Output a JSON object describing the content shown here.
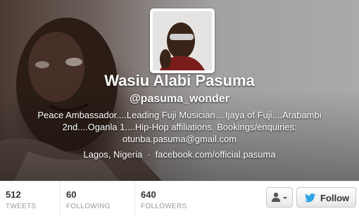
{
  "profile": {
    "name": "Wasiu Alabi Pasuma",
    "handle": "@pasuma_wonder",
    "bio": "Peace Ambassador....Leading Fuji Musician....Ijaya of Fuji....Arabambi 2nd....Oganla 1....Hip-Hop affiliations. Bookings/enquiries: otunba.pasuma@gmail.com",
    "location": "Lagos, Nigeria",
    "separator": "·",
    "website": "facebook.com/official.pasuma"
  },
  "stats": [
    {
      "value": "512",
      "label": "TWEETS"
    },
    {
      "value": "60",
      "label": "FOLLOWING"
    },
    {
      "value": "640",
      "label": "FOLLOWERS"
    }
  ],
  "actions": {
    "user_menu_icon": "person-dropdown-icon",
    "follow_label": "Follow",
    "follow_icon": "twitter-bird-icon",
    "accent": "#2aa4e4"
  }
}
